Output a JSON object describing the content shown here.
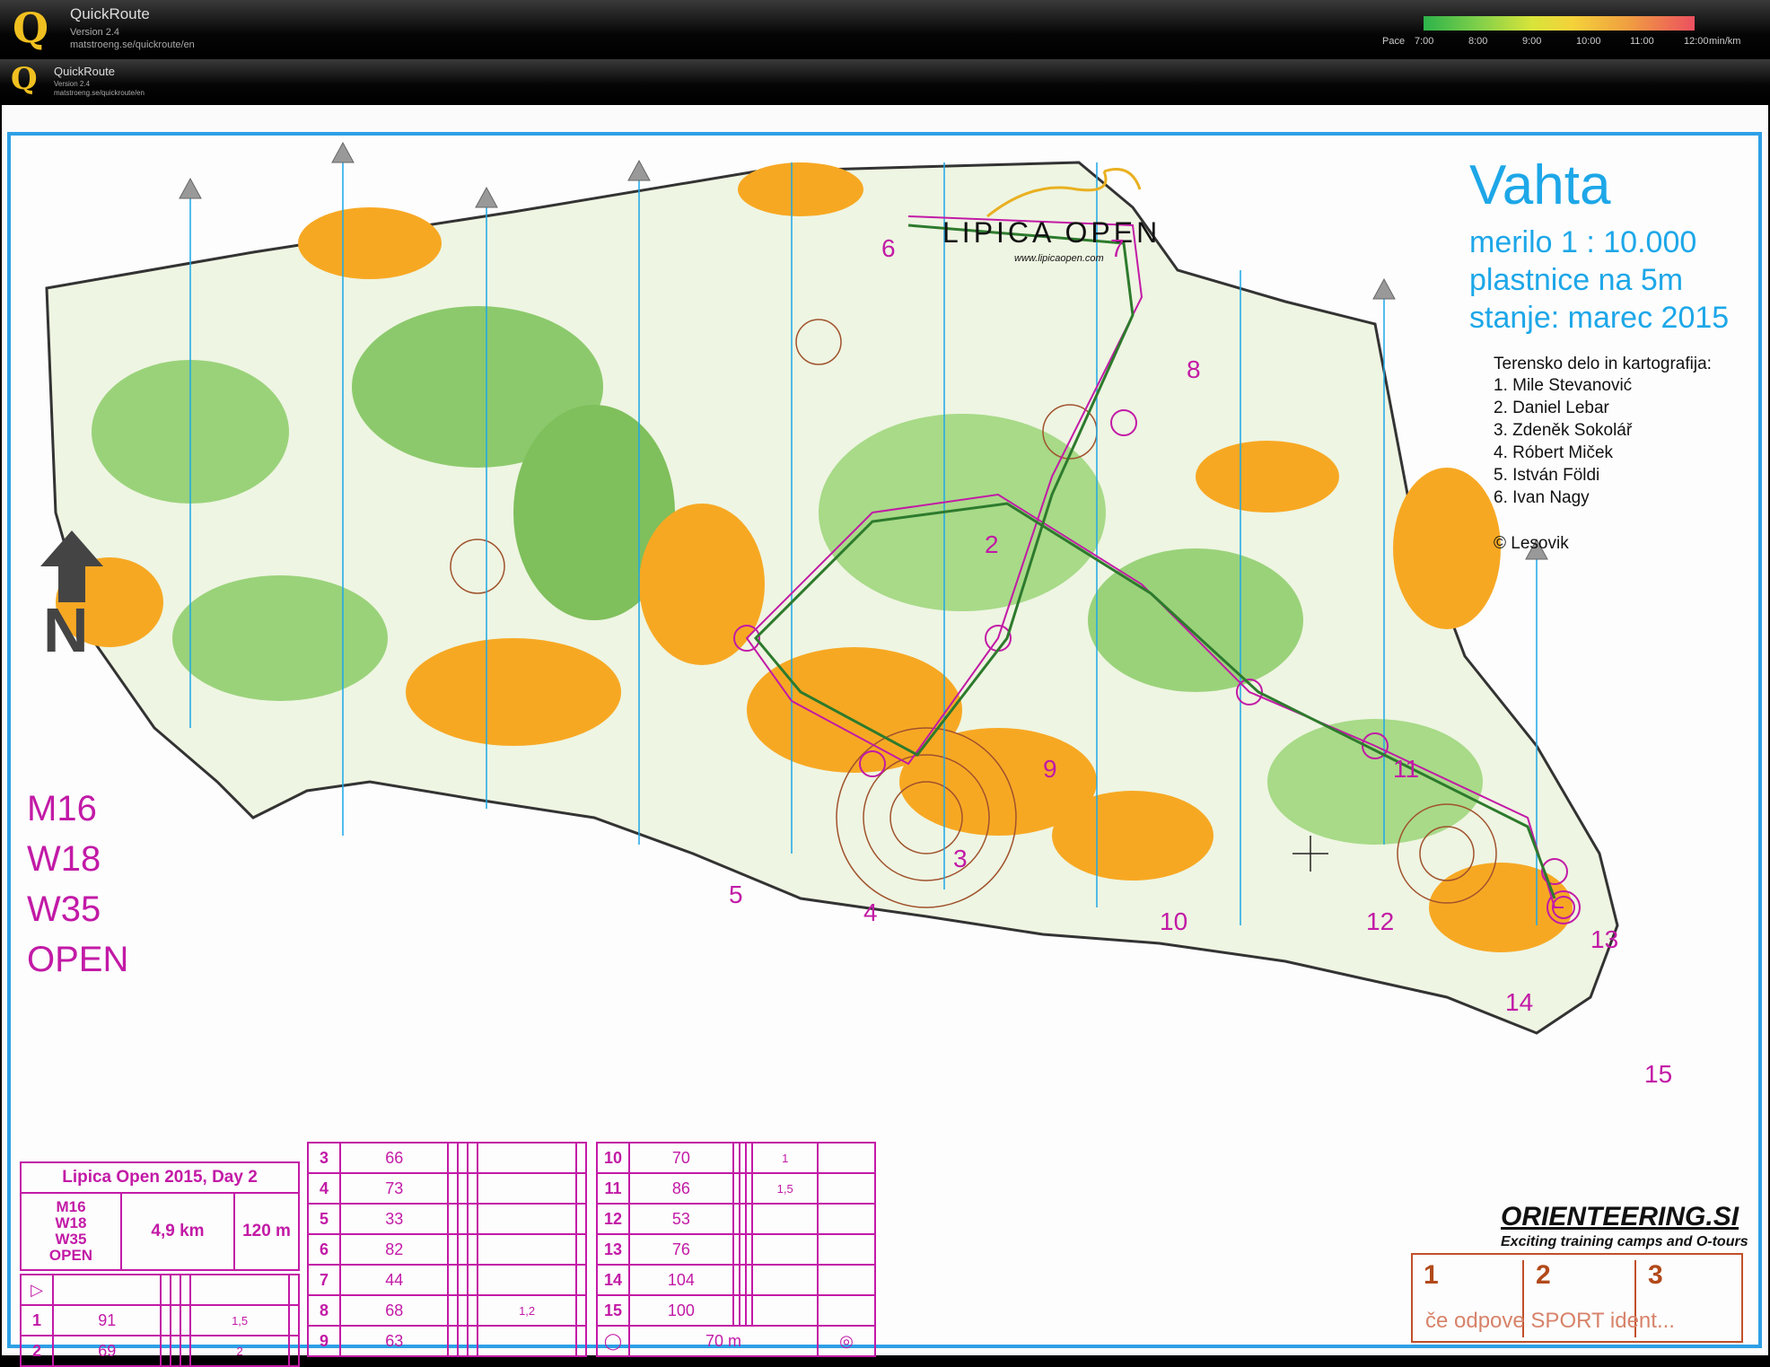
{
  "app": {
    "name": "QuickRoute",
    "version": "Version 2.4",
    "url": "matstroeng.se/quickroute/en"
  },
  "pace_legend": {
    "label": "Pace",
    "ticks": [
      "7:00",
      "8:00",
      "9:00",
      "10:00",
      "11:00",
      "12:00"
    ],
    "unit": "min/km"
  },
  "map": {
    "title": "Vahta",
    "scale": "merilo 1 : 10.000",
    "contours": "plastnice na 5m",
    "state": "stanje: marec 2015",
    "event_logo": "LIPICA OPEN",
    "event_url": "www.lipicaopen.com",
    "credits_title": "Terensko delo in kartografija:",
    "credits": [
      "1. Mile Stevanović",
      "2. Daniel Lebar",
      "3. Zdeněk Sokolář",
      "4. Róbert Miček",
      "5. István Földi",
      "6. Ivan Nagy"
    ],
    "copyright": "© Lesovik",
    "classes": [
      "M16",
      "W18",
      "W35",
      "OPEN"
    ],
    "control_numbers": [
      "2",
      "3",
      "4",
      "5",
      "6",
      "7",
      "8",
      "9",
      "10",
      "11",
      "12",
      "13",
      "14",
      "15"
    ]
  },
  "course": {
    "title": "Lipica Open 2015, Day 2",
    "classes": [
      "M16",
      "W18",
      "W35",
      "OPEN"
    ],
    "length": "4,9 km",
    "climb": "120 m",
    "controls": [
      {
        "n": "1",
        "code": "91",
        "size": "1,5"
      },
      {
        "n": "2",
        "code": "69",
        "size": "2"
      },
      {
        "n": "3",
        "code": "66",
        "size": ""
      },
      {
        "n": "4",
        "code": "73",
        "size": ""
      },
      {
        "n": "5",
        "code": "33",
        "size": ""
      },
      {
        "n": "6",
        "code": "82",
        "size": ""
      },
      {
        "n": "7",
        "code": "44",
        "size": ""
      },
      {
        "n": "8",
        "code": "68",
        "size": "1,2"
      },
      {
        "n": "9",
        "code": "63",
        "size": ""
      },
      {
        "n": "10",
        "code": "70",
        "size": "1"
      },
      {
        "n": "11",
        "code": "86",
        "size": "1,5"
      },
      {
        "n": "12",
        "code": "53",
        "size": ""
      },
      {
        "n": "13",
        "code": "76",
        "size": ""
      },
      {
        "n": "14",
        "code": "104",
        "size": ""
      },
      {
        "n": "15",
        "code": "100",
        "size": ""
      }
    ],
    "finish_distance": "70 m"
  },
  "sponsor": {
    "name": "ORIENTEERING.SI",
    "tagline": "Exciting training camps and O-tours",
    "box_numbers": [
      "1",
      "2",
      "3"
    ],
    "box_text": "če odpove SPORT ident..."
  },
  "colors": {
    "frame": "#2ea0e6",
    "course": "#c21aa6",
    "open_land": "#f7a823",
    "forest_green": "#5cb83c",
    "contour": "#a0522d"
  }
}
